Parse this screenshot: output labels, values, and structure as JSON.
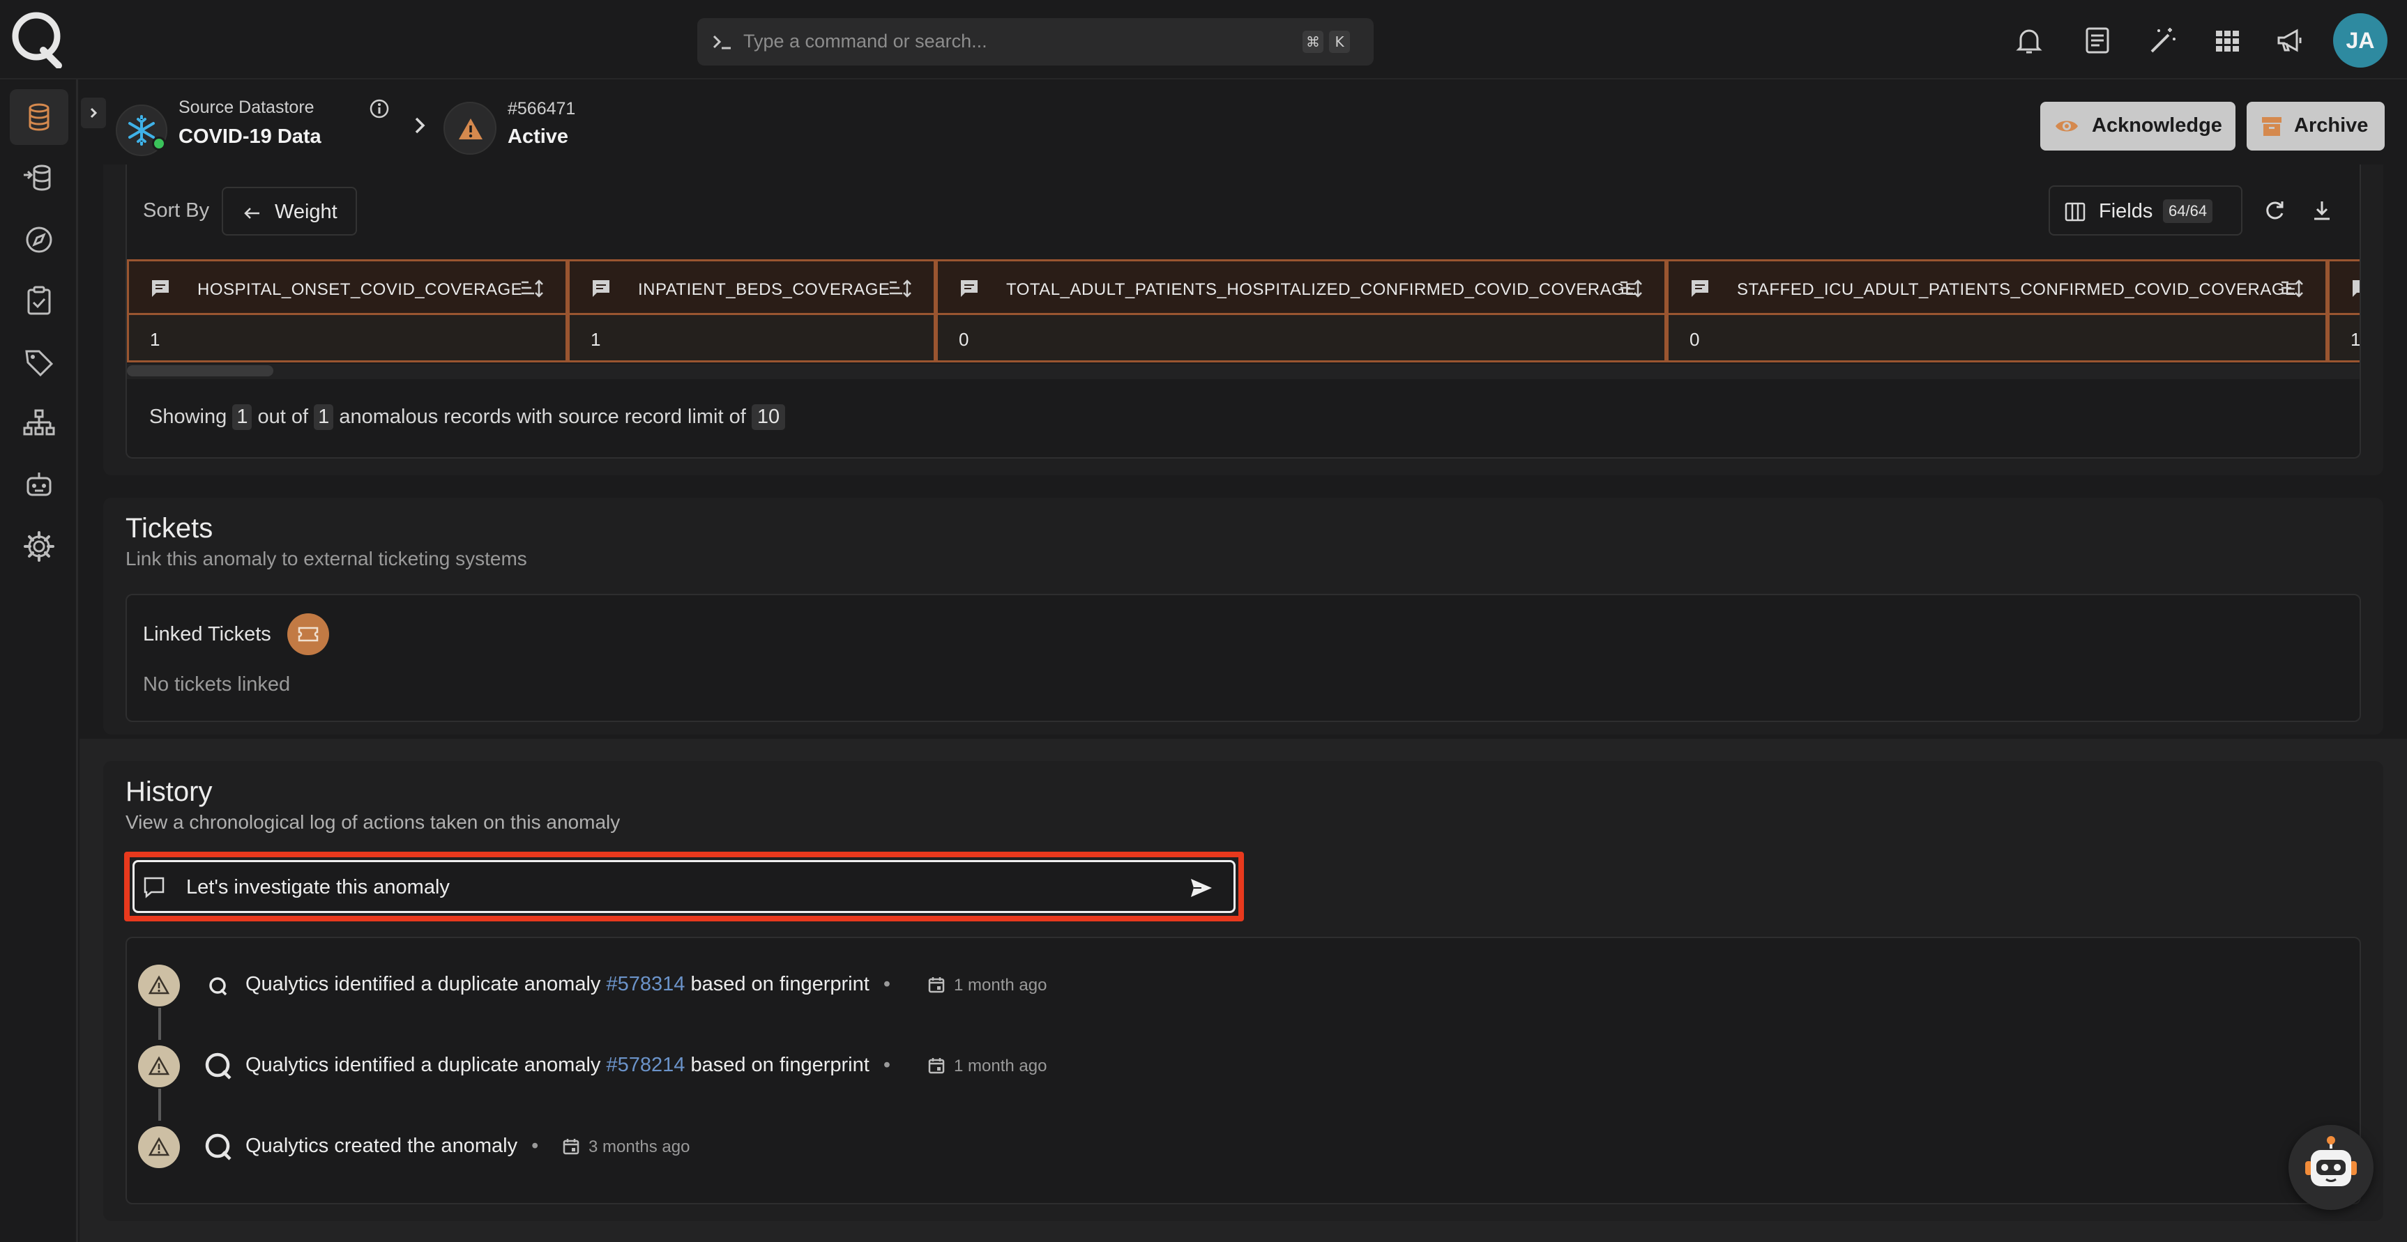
{
  "topbar": {
    "search_placeholder": "Type a command or search...",
    "shortcut_mod": "⌘",
    "shortcut_key": "K",
    "avatar_initials": "JA"
  },
  "header": {
    "datastore_label": "Source Datastore",
    "datastore_name": "COVID-19 Data",
    "anomaly_id": "#566471",
    "anomaly_status": "Active",
    "acknowledge_label": "Acknowledge",
    "archive_label": "Archive"
  },
  "records": {
    "sort_by_label": "Sort By",
    "sort_value": "Weight",
    "fields_label": "Fields",
    "fields_count": "64/64",
    "columns": [
      "HOSPITAL_ONSET_COVID_COVERAGE",
      "INPATIENT_BEDS_COVERAGE",
      "TOTAL_ADULT_PATIENTS_HOSPITALIZED_CONFIRMED_COVID_COVERAGE",
      "STAFFED_ICU_ADULT_PATIENTS_CONFIRMED_COVID_COVERAGE"
    ],
    "row": [
      "1",
      "1",
      "0",
      "0",
      "1"
    ],
    "showing_prefix": "Showing",
    "showing_count": "1",
    "out_of": "out of",
    "total_count": "1",
    "showing_suffix": "anomalous records with source record limit of",
    "limit": "10"
  },
  "tickets": {
    "title": "Tickets",
    "subtitle": "Link this anomaly to external ticketing systems",
    "linked_label": "Linked Tickets",
    "empty_text": "No tickets linked"
  },
  "history": {
    "title": "History",
    "subtitle": "View a chronological log of actions taken on this anomaly",
    "comment_value": "Let's investigate this anomaly",
    "entries": [
      {
        "prefix": "Qualytics identified a duplicate anomaly",
        "link": "#578314",
        "suffix": "based on fingerprint",
        "time": "1 month ago"
      },
      {
        "prefix": "Qualytics identified a duplicate anomaly",
        "link": "#578214",
        "suffix": "based on fingerprint",
        "time": "1 month ago"
      },
      {
        "prefix": "Qualytics created the anomaly",
        "link": "",
        "suffix": "",
        "time": "3 months ago"
      }
    ]
  },
  "colors": {
    "accent_orange": "#d5894e",
    "highlight_red": "#e8391d",
    "link_blue": "#6b93c9"
  }
}
